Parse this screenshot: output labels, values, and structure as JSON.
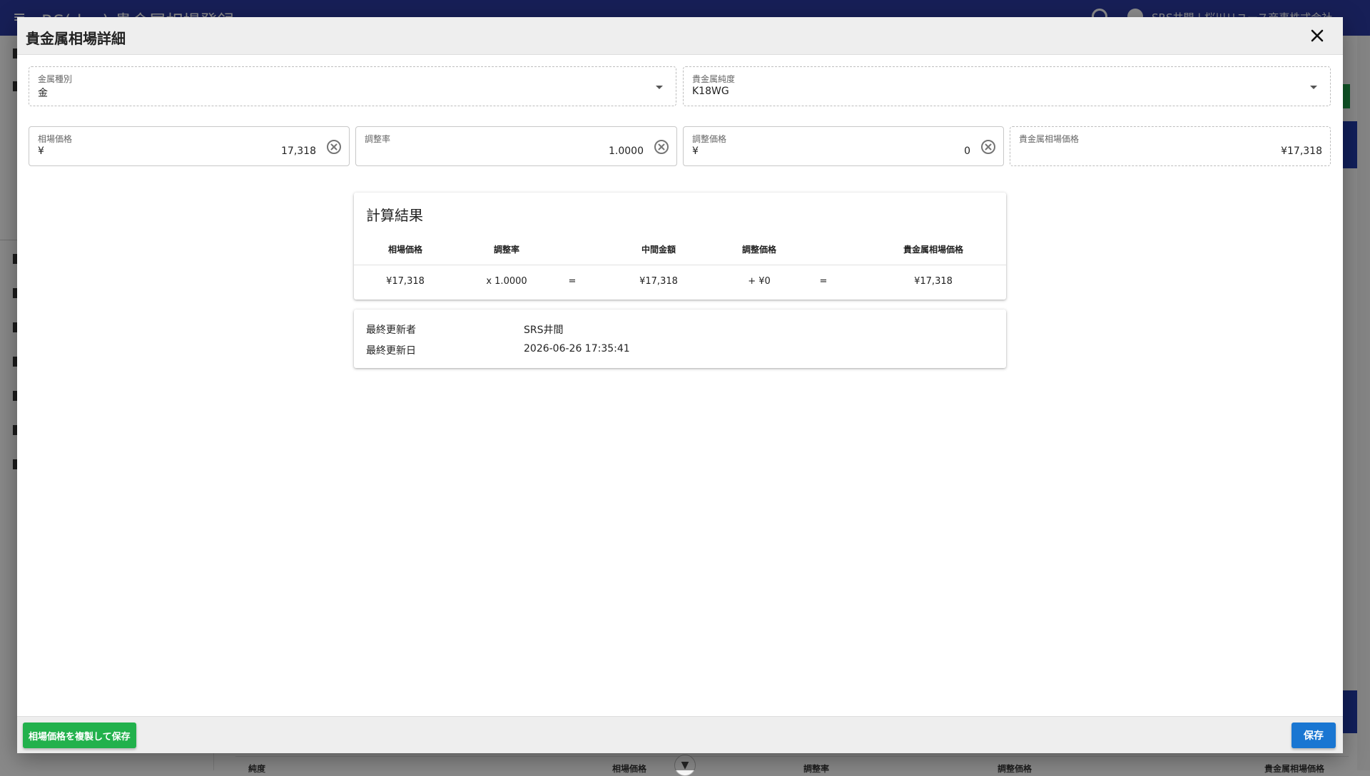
{
  "background": {
    "app_title": "RS(dev) 貴金属相場登録",
    "user_name": "SRS井間 | 桜川リユース商事株式会社",
    "table_headers": [
      "純度",
      "相場価格",
      "調整率",
      "調整価格",
      "貴金属相場価格"
    ]
  },
  "dialog": {
    "title": "貴金属相場詳細",
    "metal_type": {
      "label": "金属種別",
      "value": "金"
    },
    "purity": {
      "label": "貴金属純度",
      "value": "K18WG"
    },
    "market_price": {
      "label": "相場価格",
      "prefix": "¥",
      "value": "17,318"
    },
    "adjust_rate": {
      "label": "調整率",
      "value": "1.0000"
    },
    "adjust_price": {
      "label": "調整価格",
      "prefix": "¥",
      "value": "0"
    },
    "metal_market_price": {
      "label": "貴金属相場価格",
      "value": "¥17,318"
    },
    "calc": {
      "title": "計算結果",
      "headers": {
        "market_price": "相場価格",
        "adjust_rate": "調整率",
        "intermediate": "中間金額",
        "adjust_price": "調整価格",
        "result": "貴金属相場価格"
      },
      "row": {
        "market_price": "¥17,318",
        "adjust_rate": "x 1.0000",
        "eq1": "=",
        "intermediate": "¥17,318",
        "adjust_price": "+ ¥0",
        "eq2": "=",
        "result": "¥17,318"
      }
    },
    "meta": {
      "updated_by_label": "最終更新者",
      "updated_by": "SRS井間",
      "updated_at_label": "最終更新日",
      "updated_at": "2026-06-26 17:35:41"
    },
    "footer": {
      "duplicate_save": "相場価格を複製して保存",
      "save": "保存"
    }
  },
  "colors": {
    "topbar": "#2b3a9e",
    "duplicate_button": "#22b14c",
    "save_button": "#1976d2"
  }
}
